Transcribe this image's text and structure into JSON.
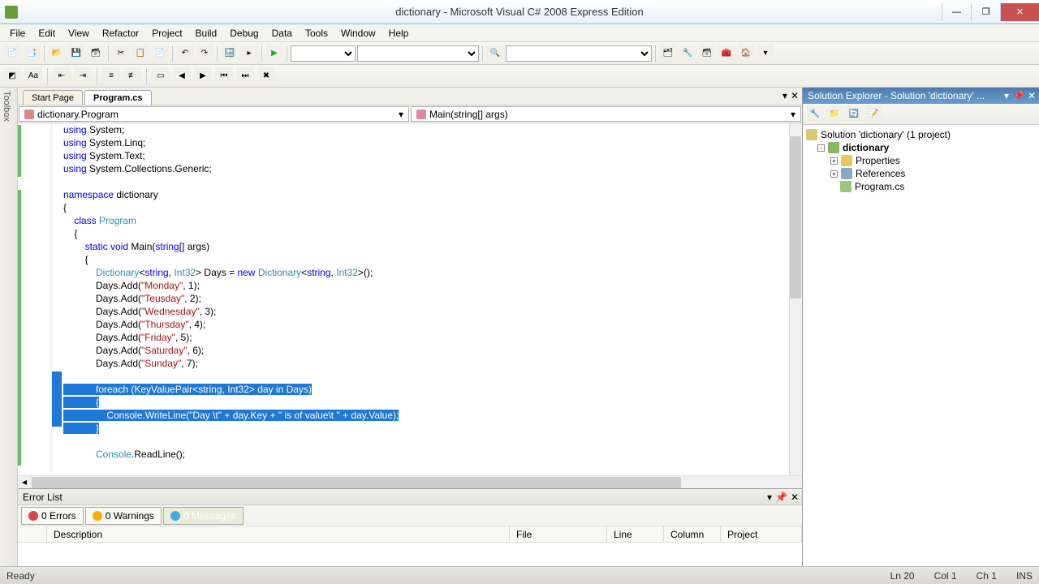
{
  "title": "dictionary - Microsoft Visual C# 2008 Express Edition",
  "menu": [
    "File",
    "Edit",
    "View",
    "Refactor",
    "Project",
    "Build",
    "Debug",
    "Data",
    "Tools",
    "Window",
    "Help"
  ],
  "tabs": {
    "start": "Start Page",
    "active": "Program.cs"
  },
  "nav": {
    "class": "dictionary.Program",
    "method": "Main(string[] args)"
  },
  "code": {
    "l1a": "using",
    "l1b": " System;",
    "l2a": "using",
    "l2b": " System.Linq;",
    "l3a": "using",
    "l3b": " System.Text;",
    "l4a": "using",
    "l4b": " System.Collections.Generic;",
    "l5a": "namespace",
    "l5b": " dictionary",
    "l7a": "    class ",
    "l7b": "Program",
    "l9a": "        static ",
    "l9b": "void",
    "l9c": " Main(",
    "l9d": "string",
    "l9e": "[] args)",
    "l11a": "            Dictionary",
    "l11b": "<",
    "l11c": "string",
    "l11d": ", ",
    "l11e": "Int32",
    "l11f": "> Days = ",
    "l11g": "new ",
    "l11h": "Dictionary",
    "l11i": "<",
    "l11j": "string",
    "l11k": ", ",
    "l11l": "Int32",
    "l11m": ">();",
    "d1a": "            Days.Add(",
    "d1b": "\"Monday\"",
    "d1c": ", 1);",
    "d2a": "            Days.Add(",
    "d2b": "\"Teusday\"",
    "d2c": ", 2);",
    "d3a": "            Days.Add(",
    "d3b": "\"Wednesday\"",
    "d3c": ", 3);",
    "d4a": "            Days.Add(",
    "d4b": "\"Thursday\"",
    "d4c": ", 4);",
    "d5a": "            Days.Add(",
    "d5b": "\"Friday\"",
    "d5c": ", 5);",
    "d6a": "            Days.Add(",
    "d6b": "\"Saturday\"",
    "d6c": ", 6);",
    "d7a": "            Days.Add(",
    "d7b": "\"Sunday\"",
    "d7c": ", 7);",
    "s1": "            foreach (KeyValuePair<string, Int32> day in Days)",
    "s2": "            {",
    "s3": "                Console.WriteLine(\"Day \\t\" + day.Key + \" is of value\\t \" + day.Value);",
    "s4": "            }",
    "r1a": "            Console",
    "r1b": ".ReadLine();",
    "ob": "{",
    "cb": "    {",
    "cb2": "        {"
  },
  "leftstrip": "Toolbox",
  "solution": {
    "title": "Solution Explorer - Solution 'dictionary' ...",
    "root": "Solution 'dictionary' (1 project)",
    "proj": "dictionary",
    "props": "Properties",
    "refs": "References",
    "file": "Program.cs"
  },
  "errlist": {
    "title": "Error List",
    "errors": "0 Errors",
    "warnings": "0 Warnings",
    "messages": "0 Messages",
    "cols": {
      "desc": "Description",
      "file": "File",
      "line": "Line",
      "col": "Column",
      "proj": "Project"
    }
  },
  "status": {
    "ready": "Ready",
    "ln": "Ln 20",
    "col": "Col 1",
    "ch": "Ch 1",
    "ins": "INS"
  }
}
